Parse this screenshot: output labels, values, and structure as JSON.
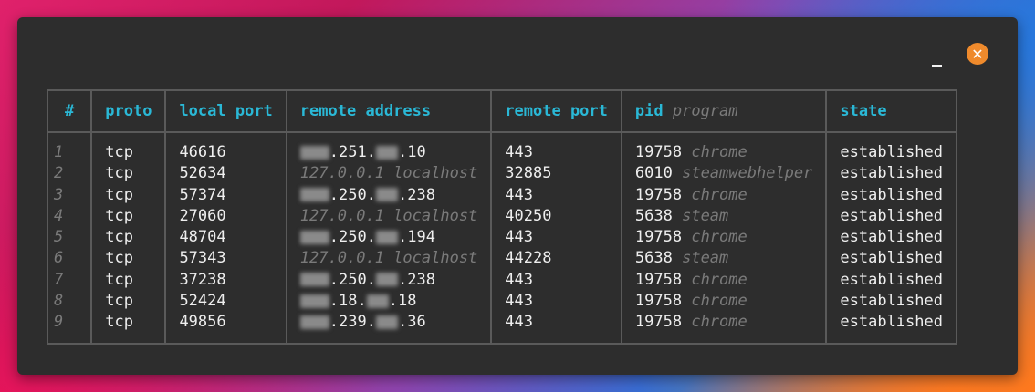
{
  "headers": {
    "idx": "#",
    "proto": "proto",
    "local_port": "local port",
    "remote_address": "remote address",
    "remote_port": "remote port",
    "pid": "pid",
    "program": "program",
    "state": "state"
  },
  "rows": [
    {
      "idx": "1",
      "proto": "tcp",
      "local_port": "46616",
      "addr_kind": "masked",
      "addr_mid": ".251.",
      "addr_end": ".10",
      "remote_port": "443",
      "pid": "19758",
      "program": "chrome",
      "state": "established"
    },
    {
      "idx": "2",
      "proto": "tcp",
      "local_port": "52634",
      "addr_kind": "local",
      "addr": "127.0.0.1",
      "host": "localhost",
      "remote_port": "32885",
      "pid": "6010",
      "program": "steamwebhelper",
      "state": "established"
    },
    {
      "idx": "3",
      "proto": "tcp",
      "local_port": "57374",
      "addr_kind": "masked",
      "addr_mid": ".250.",
      "addr_end": ".238",
      "remote_port": "443",
      "pid": "19758",
      "program": "chrome",
      "state": "established"
    },
    {
      "idx": "4",
      "proto": "tcp",
      "local_port": "27060",
      "addr_kind": "local",
      "addr": "127.0.0.1",
      "host": "localhost",
      "remote_port": "40250",
      "pid": "5638",
      "program": "steam",
      "state": "established"
    },
    {
      "idx": "5",
      "proto": "tcp",
      "local_port": "48704",
      "addr_kind": "masked",
      "addr_mid": ".250.",
      "addr_end": ".194",
      "remote_port": "443",
      "pid": "19758",
      "program": "chrome",
      "state": "established"
    },
    {
      "idx": "6",
      "proto": "tcp",
      "local_port": "57343",
      "addr_kind": "local",
      "addr": "127.0.0.1",
      "host": "localhost",
      "remote_port": "44228",
      "pid": "5638",
      "program": "steam",
      "state": "established"
    },
    {
      "idx": "7",
      "proto": "tcp",
      "local_port": "37238",
      "addr_kind": "masked",
      "addr_mid": ".250.",
      "addr_end": ".238",
      "remote_port": "443",
      "pid": "19758",
      "program": "chrome",
      "state": "established"
    },
    {
      "idx": "8",
      "proto": "tcp",
      "local_port": "52424",
      "addr_kind": "masked",
      "addr_mid": ".18.",
      "addr_end": ".18",
      "remote_port": "443",
      "pid": "19758",
      "program": "chrome",
      "state": "established"
    },
    {
      "idx": "9",
      "proto": "tcp",
      "local_port": "49856",
      "addr_kind": "masked",
      "addr_mid": ".239.",
      "addr_end": ".36",
      "remote_port": "443",
      "pid": "19758",
      "program": "chrome",
      "state": "established"
    }
  ],
  "icons": {
    "minimize": "minimize-icon",
    "close": "close-icon"
  },
  "colors": {
    "header": "#2ab8d6",
    "close_button": "#ef8a2c",
    "window_bg": "#2d2d2d"
  }
}
